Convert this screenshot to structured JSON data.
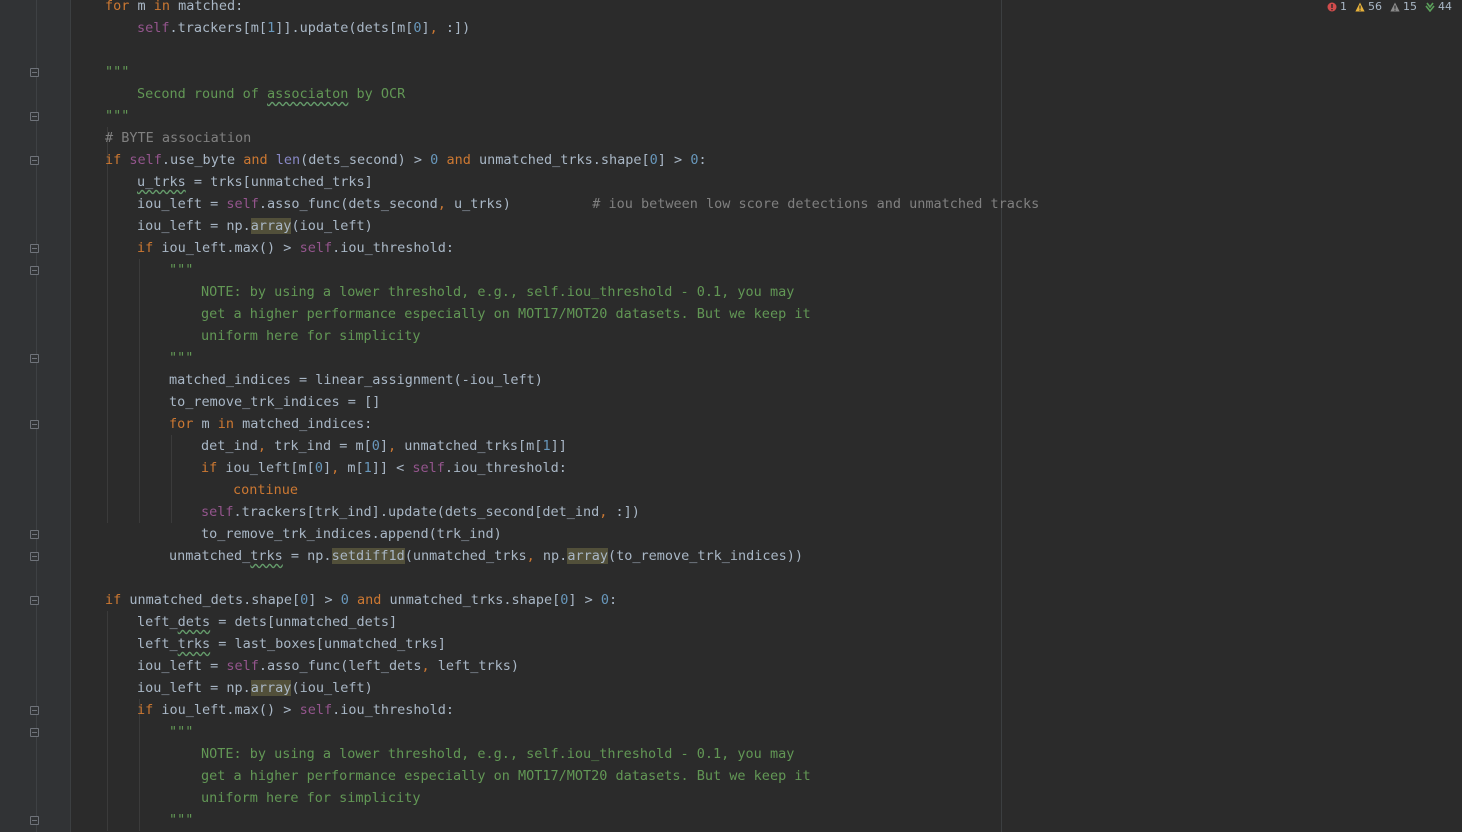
{
  "status_bar": {
    "errors": "1",
    "warnings": "56",
    "weak_warnings": "15",
    "typos": "44",
    "colors": {
      "error": "#d14c4c",
      "warning": "#e8b23a",
      "weak_warning": "#8a8a8a",
      "typo": "#5aa05a"
    }
  },
  "code_lines": [
    [
      [
        "k",
        "for"
      ],
      [
        "p",
        " m "
      ],
      [
        "k",
        "in"
      ],
      [
        "p",
        " matched:"
      ]
    ],
    [
      [
        "s",
        "self"
      ],
      [
        "p",
        ".trackers[m["
      ],
      [
        "n",
        "1"
      ],
      [
        "p",
        "]].update(dets[m["
      ],
      [
        "n",
        "0"
      ],
      [
        "p",
        "]"
      ],
      [
        "k",
        ","
      ],
      [
        "p",
        " :])"
      ]
    ],
    [],
    [
      [
        "d",
        "\"\"\""
      ]
    ],
    [
      [
        "d",
        "Second round of "
      ],
      [
        "dt",
        "associaton"
      ],
      [
        "d",
        " by OCR"
      ]
    ],
    [
      [
        "d",
        "\"\"\""
      ]
    ],
    [
      [
        "c",
        "# BYTE association"
      ]
    ],
    [
      [
        "k",
        "if"
      ],
      [
        "p",
        " "
      ],
      [
        "s",
        "self"
      ],
      [
        "p",
        ".use_byte "
      ],
      [
        "k",
        "and"
      ],
      [
        "p",
        " "
      ],
      [
        "b",
        "len"
      ],
      [
        "p",
        "(dets_second) > "
      ],
      [
        "n",
        "0"
      ],
      [
        "p",
        " "
      ],
      [
        "k",
        "and"
      ],
      [
        "p",
        " unmatched_trks.shape["
      ],
      [
        "n",
        "0"
      ],
      [
        "p",
        "] > "
      ],
      [
        "n",
        "0"
      ],
      [
        "p",
        ":"
      ]
    ],
    [
      [
        "t",
        "u_trks"
      ],
      [
        "p",
        " = trks[unmatched_trks]"
      ]
    ],
    [
      [
        "p",
        "iou_left = "
      ],
      [
        "s",
        "self"
      ],
      [
        "p",
        ".asso_func(dets_second"
      ],
      [
        "k",
        ","
      ],
      [
        "p",
        " u_trks)          "
      ],
      [
        "c",
        "# iou between low score detections and unmatched tracks"
      ]
    ],
    [
      [
        "p",
        "iou_left = np."
      ],
      [
        "h",
        "array"
      ],
      [
        "p",
        "(iou_left)"
      ]
    ],
    [
      [
        "k",
        "if"
      ],
      [
        "p",
        " iou_left.max() > "
      ],
      [
        "s",
        "self"
      ],
      [
        "p",
        ".iou_threshold:"
      ]
    ],
    [
      [
        "d",
        "\"\"\""
      ]
    ],
    [
      [
        "d",
        "NOTE: by using a lower threshold, e.g., self.iou_threshold - 0.1, you may"
      ]
    ],
    [
      [
        "d",
        "get a higher performance especially on MOT17/MOT20 datasets. But we keep it"
      ]
    ],
    [
      [
        "d",
        "uniform here for simplicity"
      ]
    ],
    [
      [
        "d",
        "\"\"\""
      ]
    ],
    [
      [
        "p",
        "matched_indices = linear_assignment(-iou_left)"
      ]
    ],
    [
      [
        "p",
        "to_remove_trk_indices = []"
      ]
    ],
    [
      [
        "k",
        "for"
      ],
      [
        "p",
        " m "
      ],
      [
        "k",
        "in"
      ],
      [
        "p",
        " matched_indices:"
      ]
    ],
    [
      [
        "p",
        "det_ind"
      ],
      [
        "k",
        ","
      ],
      [
        "p",
        " trk_ind = m["
      ],
      [
        "n",
        "0"
      ],
      [
        "p",
        "]"
      ],
      [
        "k",
        ","
      ],
      [
        "p",
        " unmatched_trks[m["
      ],
      [
        "n",
        "1"
      ],
      [
        "p",
        "]]"
      ]
    ],
    [
      [
        "k",
        "if"
      ],
      [
        "p",
        " iou_left[m["
      ],
      [
        "n",
        "0"
      ],
      [
        "p",
        "]"
      ],
      [
        "k",
        ","
      ],
      [
        "p",
        " m["
      ],
      [
        "n",
        "1"
      ],
      [
        "p",
        "]] < "
      ],
      [
        "s",
        "self"
      ],
      [
        "p",
        ".iou_threshold:"
      ]
    ],
    [
      [
        "k",
        "continue"
      ]
    ],
    [
      [
        "s",
        "self"
      ],
      [
        "p",
        ".trackers[trk_ind].update(dets_second[det_ind"
      ],
      [
        "k",
        ","
      ],
      [
        "p",
        " :])"
      ]
    ],
    [
      [
        "p",
        "to_remove_trk_indices.append(trk_ind)"
      ]
    ],
    [
      [
        "p",
        "unmatched_"
      ],
      [
        "t",
        "trks"
      ],
      [
        "p",
        " = np."
      ],
      [
        "h",
        "setdiff1d"
      ],
      [
        "p",
        "(unmatched_trks"
      ],
      [
        "k",
        ","
      ],
      [
        "p",
        " np."
      ],
      [
        "h",
        "array"
      ],
      [
        "p",
        "(to_remove_trk_indices))"
      ]
    ],
    [],
    [
      [
        "k",
        "if"
      ],
      [
        "p",
        " unmatched_dets.shape["
      ],
      [
        "n",
        "0"
      ],
      [
        "p",
        "] > "
      ],
      [
        "n",
        "0"
      ],
      [
        "p",
        " "
      ],
      [
        "k",
        "and"
      ],
      [
        "p",
        " unmatched_trks.shape["
      ],
      [
        "n",
        "0"
      ],
      [
        "p",
        "] > "
      ],
      [
        "n",
        "0"
      ],
      [
        "p",
        ":"
      ]
    ],
    [
      [
        "p",
        "left_"
      ],
      [
        "t",
        "dets"
      ],
      [
        "p",
        " = dets[unmatched_dets]"
      ]
    ],
    [
      [
        "p",
        "left_"
      ],
      [
        "t",
        "trks"
      ],
      [
        "p",
        " = last_boxes[unmatched_trks]"
      ]
    ],
    [
      [
        "p",
        "iou_left = "
      ],
      [
        "s",
        "self"
      ],
      [
        "p",
        ".asso_func(left_dets"
      ],
      [
        "k",
        ","
      ],
      [
        "p",
        " left_trks)"
      ]
    ],
    [
      [
        "p",
        "iou_left = np."
      ],
      [
        "h",
        "array"
      ],
      [
        "p",
        "(iou_left)"
      ]
    ],
    [
      [
        "k",
        "if"
      ],
      [
        "p",
        " iou_left.max() > "
      ],
      [
        "s",
        "self"
      ],
      [
        "p",
        ".iou_threshold:"
      ]
    ],
    [
      [
        "d",
        "\"\"\""
      ]
    ],
    [
      [
        "d",
        "NOTE: by using a lower threshold, e.g., self.iou_threshold - 0.1, you may"
      ]
    ],
    [
      [
        "d",
        "get a higher performance especially on MOT17/MOT20 datasets. But we keep it"
      ]
    ],
    [
      [
        "d",
        "uniform here for simplicity"
      ]
    ],
    [
      [
        "d",
        "\"\"\""
      ]
    ]
  ]
}
